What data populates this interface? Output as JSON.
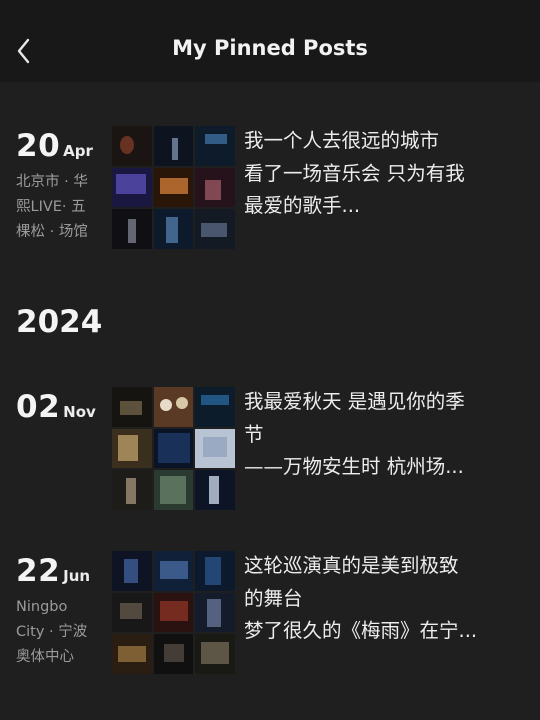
{
  "header": {
    "title": "My Pinned Posts",
    "back_icon": "chevron-left-icon"
  },
  "year_section": "2024",
  "posts": [
    {
      "day": "20",
      "month": "Apr",
      "location": [
        "北京市 · 华",
        "熙LIVE· 五",
        "棵松 · 场馆"
      ],
      "caption": [
        "我一个人去很远的城市",
        "看了一场音乐会 只为有我",
        "最爱的歌手..."
      ]
    },
    {
      "day": "02",
      "month": "Nov",
      "location": [],
      "caption": [
        "我最爱秋天 是遇见你的季",
        "节",
        "——万物安生时 杭州场..."
      ]
    },
    {
      "day": "22",
      "month": "Jun",
      "location": [
        "Ningbo",
        "City · 宁波",
        "奥体中心"
      ],
      "caption": [
        "这轮巡演真的是美到极致",
        "的舞台",
        "梦了很久的《梅雨》在宁..."
      ]
    }
  ],
  "colors": {
    "background": "#1f1f1f",
    "header_background": "#181818",
    "primary_text": "#f2f2f2",
    "secondary_text": "#9a9a9a"
  }
}
